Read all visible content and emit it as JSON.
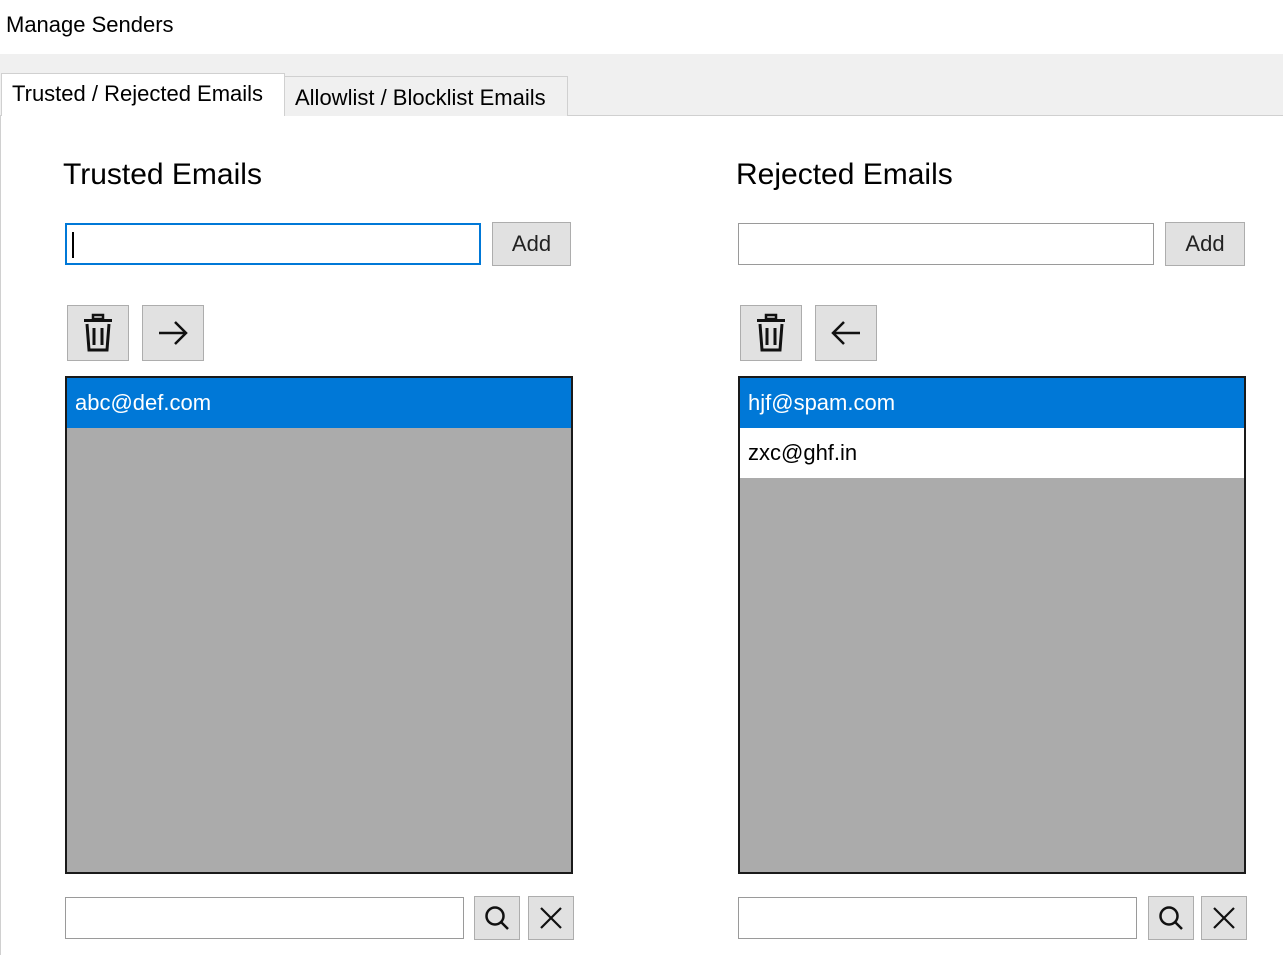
{
  "window": {
    "title": "Manage Senders"
  },
  "tabs": [
    {
      "label": "Trusted / Rejected Emails",
      "active": true
    },
    {
      "label": "Allowlist / Blocklist Emails",
      "active": false
    }
  ],
  "trusted": {
    "heading": "Trusted Emails",
    "input_value": "",
    "add_label": "Add",
    "delete_icon": "trash-icon",
    "move_icon": "arrow-right-icon",
    "items": [
      {
        "text": "abc@def.com",
        "selected": true
      }
    ],
    "search_value": "",
    "search_icon": "search-icon",
    "clear_icon": "close-icon"
  },
  "rejected": {
    "heading": "Rejected Emails",
    "input_value": "",
    "add_label": "Add",
    "delete_icon": "trash-icon",
    "move_icon": "arrow-left-icon",
    "items": [
      {
        "text": "hjf@spam.com",
        "selected": true
      },
      {
        "text": "zxc@ghf.in",
        "selected": false
      }
    ],
    "search_value": "",
    "search_icon": "search-icon",
    "clear_icon": "close-icon"
  },
  "colors": {
    "selection": "#0078d7",
    "list_background": "#ababab",
    "tab_strip": "#f0f0f0",
    "button_face": "#e1e1e1"
  }
}
